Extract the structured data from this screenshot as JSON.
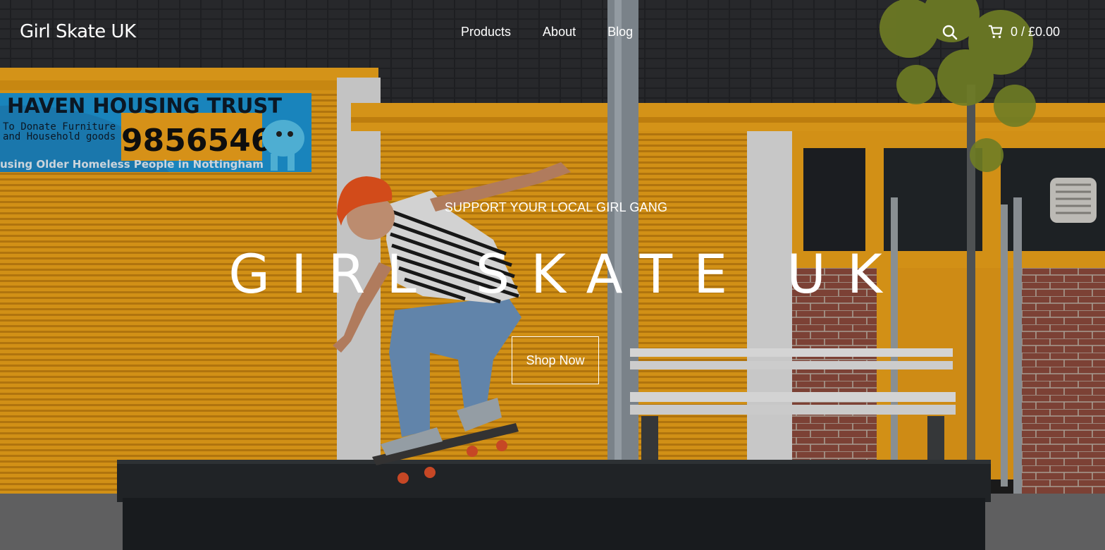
{
  "header": {
    "logo": "Girl Skate UK",
    "nav": [
      "Products",
      "About",
      "Blog"
    ],
    "cart_total": "0 / £0.00"
  },
  "hero": {
    "eyebrow": "SUPPORT YOUR LOCAL GIRL GANG",
    "title": "GIRL SKATE UK",
    "cta": "Shop Now"
  },
  "background": {
    "sign_line1": "HAVEN HOUSING TRUST",
    "sign_line2": "To Donate Furniture",
    "sign_line3": "and Household goods",
    "sign_phone": "9856546",
    "sign_line4": "using Older Homeless People in Nottingham"
  },
  "icons": {
    "search": "search-icon",
    "cart": "cart-icon"
  },
  "colors": {
    "shutter": "#f0a519",
    "roof": "#2b2b2d",
    "ledge": "#1f2124",
    "beanie": "#f05a1e",
    "accent_text": "#ffffff"
  }
}
